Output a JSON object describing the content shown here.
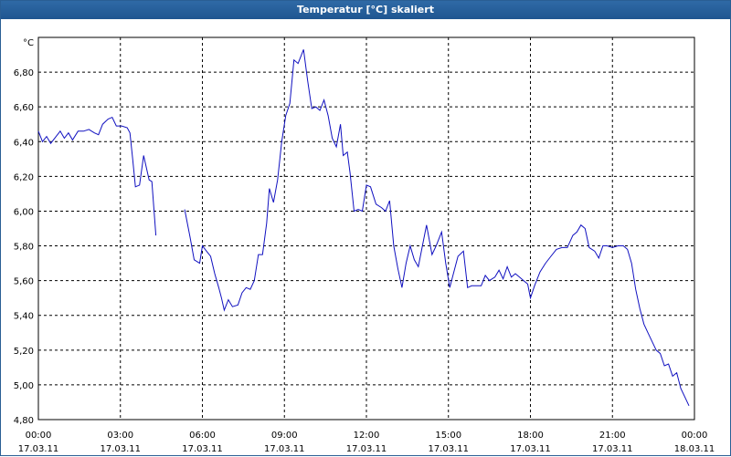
{
  "window": {
    "title": "Temperatur [°C] skaliert"
  },
  "chart_data": {
    "type": "line",
    "title": "Temperatur [°C] skaliert",
    "ylabel": "°C",
    "xlabel": "",
    "ylim": [
      4.8,
      7.0
    ],
    "xlim": [
      0,
      24
    ],
    "grid": true,
    "y_ticks": [
      "4,80",
      "5,00",
      "5,20",
      "5,40",
      "5,60",
      "5,80",
      "6,00",
      "6,20",
      "6,40",
      "6,60",
      "6,80"
    ],
    "x_ticks": [
      {
        "time": "00:00",
        "date": "17.03.11"
      },
      {
        "time": "03:00",
        "date": "17.03.11"
      },
      {
        "time": "06:00",
        "date": "17.03.11"
      },
      {
        "time": "09:00",
        "date": "17.03.11"
      },
      {
        "time": "12:00",
        "date": "17.03.11"
      },
      {
        "time": "15:00",
        "date": "17.03.11"
      },
      {
        "time": "18:00",
        "date": "17.03.11"
      },
      {
        "time": "21:00",
        "date": "17.03.11"
      },
      {
        "time": "00:00",
        "date": "18.03.11"
      }
    ],
    "series": [
      {
        "color": "#1010c0",
        "segments": [
          [
            [
              0.0,
              6.46
            ],
            [
              0.15,
              6.4
            ],
            [
              0.3,
              6.43
            ],
            [
              0.45,
              6.39
            ],
            [
              0.65,
              6.43
            ],
            [
              0.8,
              6.46
            ],
            [
              0.95,
              6.42
            ],
            [
              1.1,
              6.45
            ],
            [
              1.25,
              6.41
            ],
            [
              1.45,
              6.46
            ],
            [
              1.65,
              6.46
            ],
            [
              1.85,
              6.47
            ],
            [
              2.05,
              6.45
            ],
            [
              2.2,
              6.44
            ],
            [
              2.35,
              6.5
            ],
            [
              2.55,
              6.53
            ],
            [
              2.7,
              6.54
            ],
            [
              2.85,
              6.49
            ],
            [
              3.05,
              6.49
            ],
            [
              3.25,
              6.48
            ],
            [
              3.35,
              6.45
            ],
            [
              3.45,
              6.3
            ],
            [
              3.55,
              6.14
            ],
            [
              3.7,
              6.15
            ],
            [
              3.85,
              6.32
            ],
            [
              4.05,
              6.18
            ],
            [
              4.15,
              6.17
            ],
            [
              4.3,
              5.86
            ]
          ],
          [
            [
              5.35,
              6.01
            ],
            [
              5.55,
              5.85
            ],
            [
              5.7,
              5.72
            ],
            [
              5.9,
              5.7
            ],
            [
              6.0,
              5.8
            ],
            [
              6.15,
              5.77
            ],
            [
              6.3,
              5.74
            ],
            [
              6.45,
              5.64
            ],
            [
              6.6,
              5.56
            ],
            [
              6.7,
              5.5
            ],
            [
              6.8,
              5.43
            ],
            [
              6.95,
              5.49
            ],
            [
              7.1,
              5.45
            ],
            [
              7.3,
              5.46
            ],
            [
              7.45,
              5.53
            ],
            [
              7.6,
              5.56
            ],
            [
              7.75,
              5.55
            ],
            [
              7.9,
              5.6
            ],
            [
              8.05,
              5.75
            ],
            [
              8.2,
              5.75
            ],
            [
              8.35,
              5.93
            ],
            [
              8.45,
              6.13
            ],
            [
              8.6,
              6.05
            ],
            [
              8.75,
              6.18
            ],
            [
              8.9,
              6.4
            ],
            [
              9.05,
              6.55
            ],
            [
              9.2,
              6.62
            ],
            [
              9.35,
              6.87
            ],
            [
              9.5,
              6.85
            ],
            [
              9.7,
              6.93
            ],
            [
              9.85,
              6.75
            ],
            [
              10.0,
              6.59
            ],
            [
              10.15,
              6.6
            ],
            [
              10.3,
              6.58
            ],
            [
              10.45,
              6.64
            ],
            [
              10.6,
              6.55
            ],
            [
              10.75,
              6.42
            ],
            [
              10.9,
              6.37
            ],
            [
              11.05,
              6.5
            ],
            [
              11.15,
              6.32
            ],
            [
              11.3,
              6.34
            ],
            [
              11.4,
              6.22
            ],
            [
              11.55,
              6.0
            ],
            [
              11.7,
              6.01
            ],
            [
              11.85,
              6.0
            ],
            [
              12.0,
              6.15
            ],
            [
              12.15,
              6.14
            ],
            [
              12.35,
              6.04
            ],
            [
              12.55,
              6.02
            ],
            [
              12.7,
              6.0
            ],
            [
              12.85,
              6.06
            ],
            [
              13.0,
              5.8
            ],
            [
              13.15,
              5.67
            ],
            [
              13.3,
              5.56
            ],
            [
              13.45,
              5.7
            ],
            [
              13.6,
              5.8
            ],
            [
              13.75,
              5.72
            ],
            [
              13.9,
              5.68
            ],
            [
              14.05,
              5.8
            ],
            [
              14.2,
              5.92
            ],
            [
              14.4,
              5.75
            ],
            [
              14.55,
              5.8
            ],
            [
              14.75,
              5.88
            ],
            [
              14.9,
              5.7
            ],
            [
              15.05,
              5.56
            ],
            [
              15.2,
              5.65
            ],
            [
              15.35,
              5.74
            ],
            [
              15.55,
              5.77
            ],
            [
              15.7,
              5.56
            ],
            [
              15.85,
              5.57
            ],
            [
              16.05,
              5.57
            ],
            [
              16.2,
              5.57
            ],
            [
              16.35,
              5.63
            ],
            [
              16.5,
              5.6
            ],
            [
              16.7,
              5.62
            ],
            [
              16.85,
              5.66
            ],
            [
              17.0,
              5.61
            ],
            [
              17.15,
              5.68
            ],
            [
              17.3,
              5.62
            ],
            [
              17.45,
              5.64
            ],
            [
              17.6,
              5.62
            ],
            [
              17.75,
              5.6
            ],
            [
              17.9,
              5.58
            ],
            [
              18.0,
              5.5
            ],
            [
              18.15,
              5.57
            ],
            [
              18.35,
              5.65
            ],
            [
              18.55,
              5.7
            ],
            [
              18.75,
              5.74
            ],
            [
              18.95,
              5.78
            ],
            [
              19.15,
              5.79
            ],
            [
              19.35,
              5.79
            ],
            [
              19.55,
              5.86
            ],
            [
              19.7,
              5.88
            ],
            [
              19.85,
              5.92
            ],
            [
              20.0,
              5.9
            ],
            [
              20.15,
              5.79
            ],
            [
              20.35,
              5.77
            ],
            [
              20.5,
              5.73
            ],
            [
              20.65,
              5.8
            ],
            [
              20.8,
              5.8
            ],
            [
              21.0,
              5.79
            ],
            [
              21.2,
              5.8
            ],
            [
              21.4,
              5.8
            ],
            [
              21.55,
              5.78
            ],
            [
              21.7,
              5.7
            ],
            [
              21.85,
              5.55
            ],
            [
              22.0,
              5.44
            ],
            [
              22.15,
              5.35
            ],
            [
              22.3,
              5.3
            ],
            [
              22.45,
              5.25
            ],
            [
              22.6,
              5.2
            ],
            [
              22.75,
              5.18
            ],
            [
              22.9,
              5.11
            ],
            [
              23.05,
              5.12
            ],
            [
              23.2,
              5.05
            ],
            [
              23.35,
              5.07
            ],
            [
              23.5,
              4.98
            ],
            [
              23.65,
              4.93
            ],
            [
              23.8,
              4.88
            ]
          ]
        ]
      }
    ]
  }
}
